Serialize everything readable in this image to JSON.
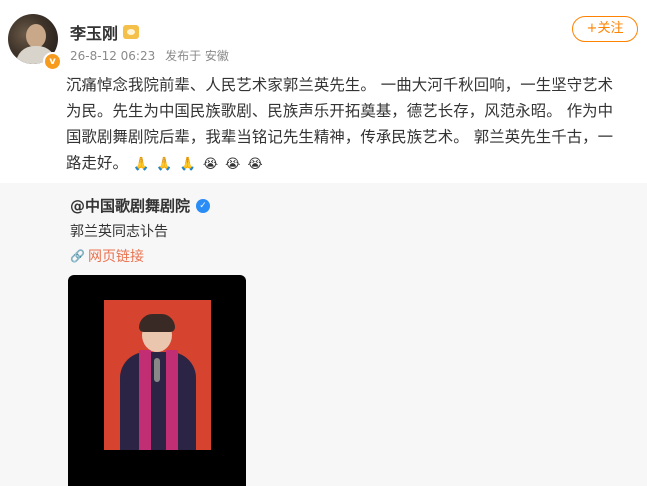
{
  "post": {
    "author": "李玉刚",
    "time": "26-8-12 06:23",
    "source": "发布于 安徽",
    "follow_label": "+关注",
    "lines": [
      "沉痛悼念我院前辈、人民艺术家郭兰英先生。 一曲大河千秋回响，一生坚守艺术",
      "为民。先生为中国民族歌剧、民族声乐开拓奠基，德艺长存，风范永昭。 作为中",
      "国歌剧舞剧院后辈，我辈当铭记先生精神，传承民族艺术。 郭兰英先生千古，一",
      "路走好。"
    ],
    "emojis": [
      "🙏",
      "🙏",
      "🙏",
      "😭",
      "😭",
      "😭"
    ]
  },
  "repost": {
    "author": "@中国歌剧舞剧院",
    "text": "郭兰英同志讣告",
    "link_label": "网页链接"
  },
  "icons": {
    "avatar_badge": "v-badge-icon",
    "member": "crown-icon",
    "verified": "blue-v-icon",
    "link": "link-icon"
  },
  "colors": {
    "accent": "#ff8200",
    "link": "#eb7350",
    "verified": "#2a8cf5"
  }
}
